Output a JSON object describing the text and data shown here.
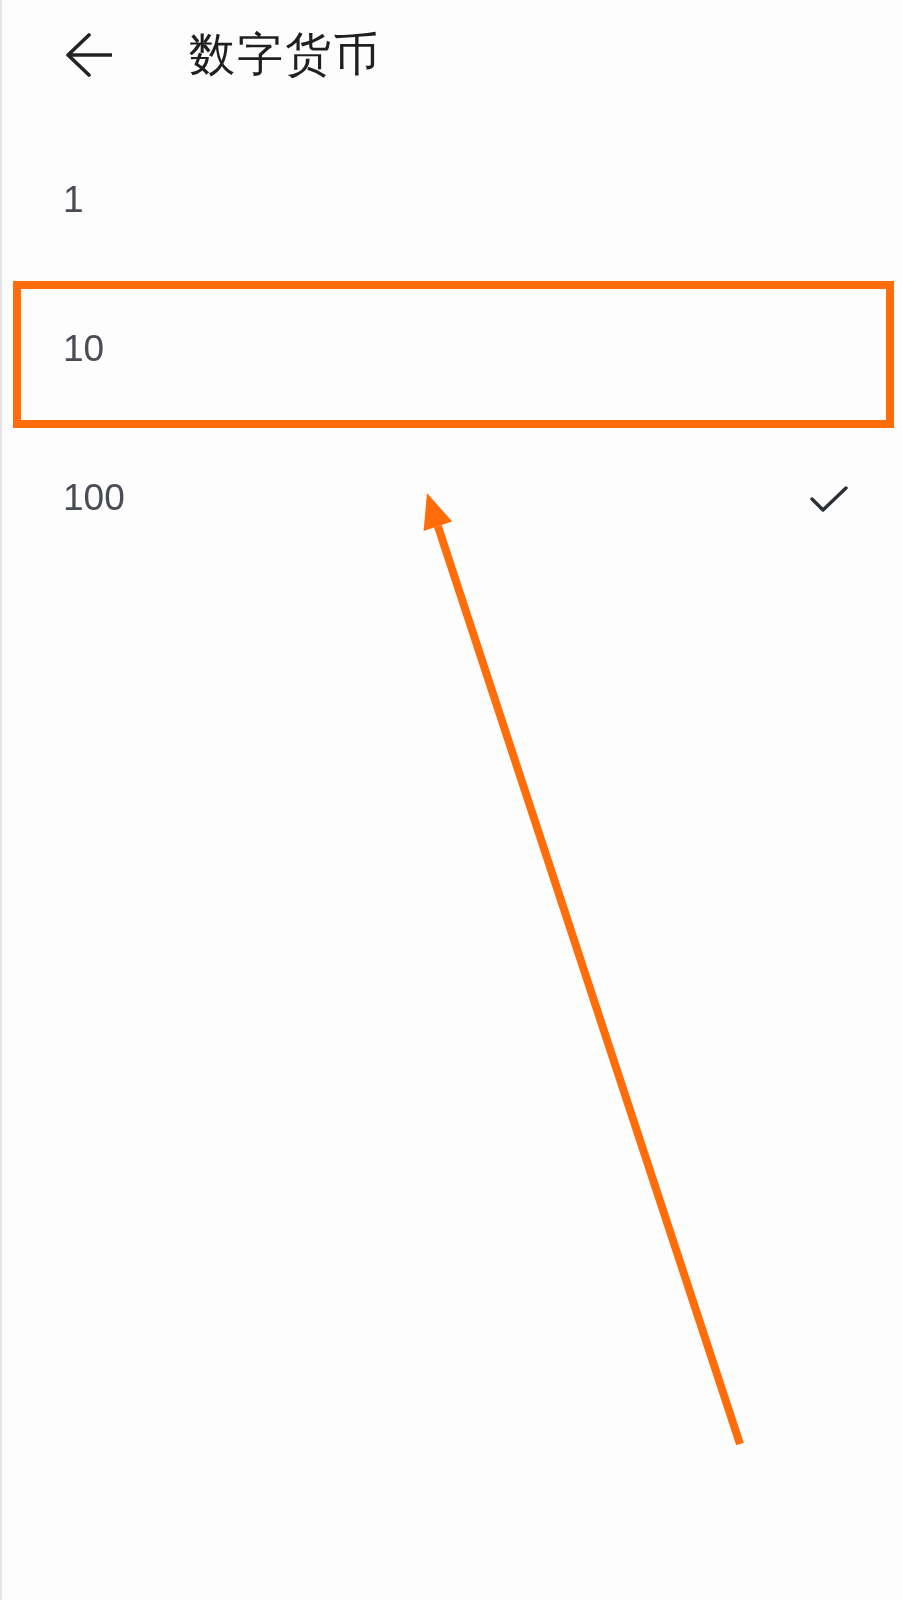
{
  "header": {
    "title": "数字货币"
  },
  "options": [
    {
      "label": "1",
      "selected": false,
      "highlighted": false
    },
    {
      "label": "10",
      "selected": false,
      "highlighted": true
    },
    {
      "label": "100",
      "selected": true,
      "highlighted": false
    }
  ],
  "annotations": [
    {
      "kind": "arrow"
    }
  ]
}
